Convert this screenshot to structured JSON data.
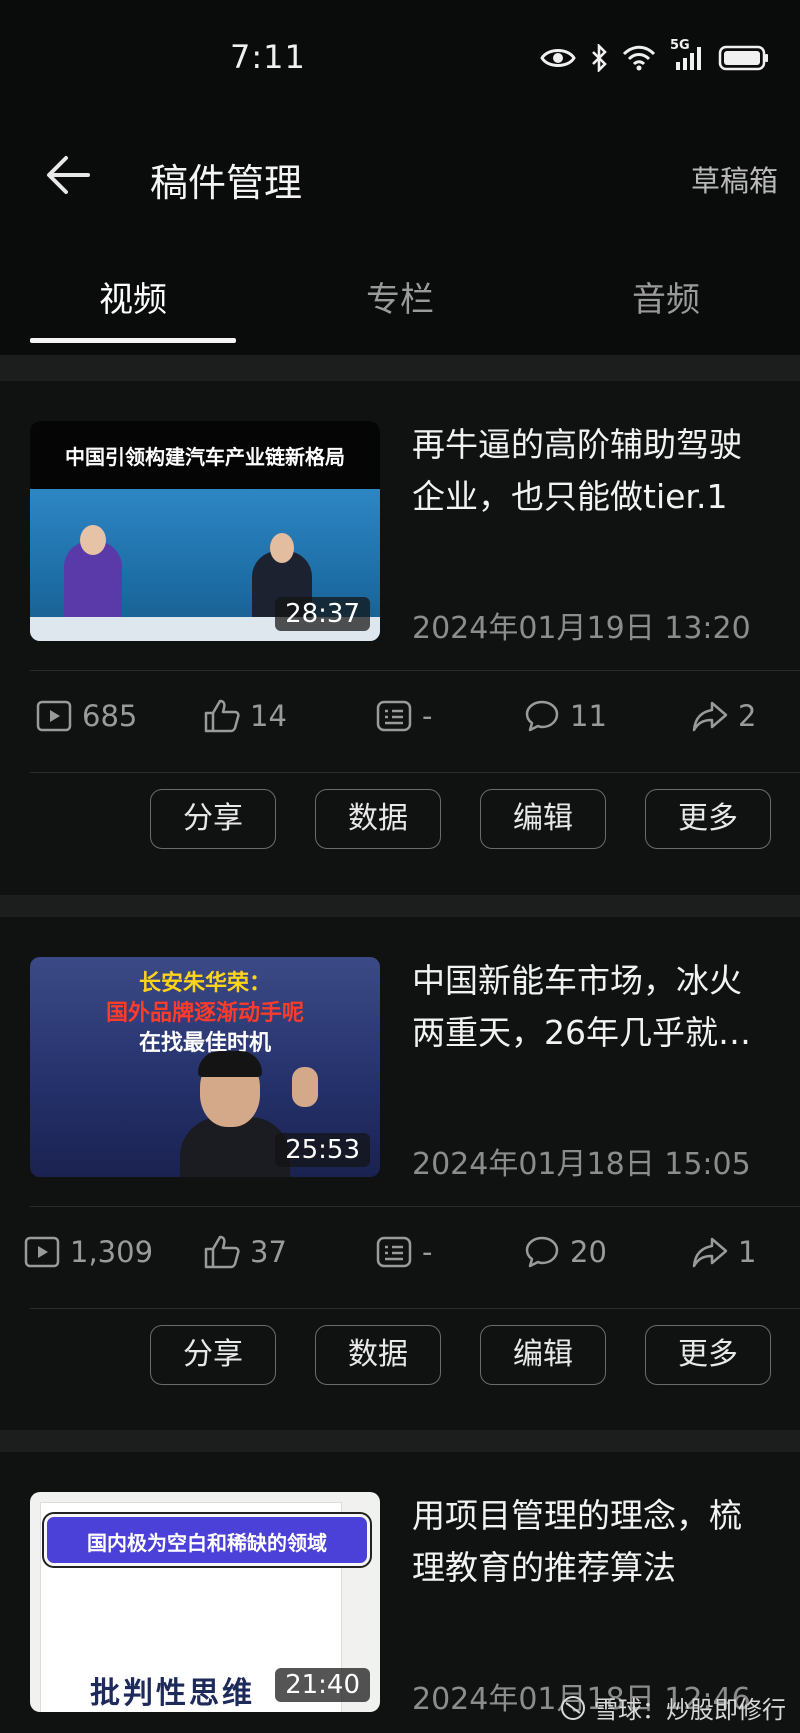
{
  "status_bar": {
    "time": "7:11",
    "network": "5G",
    "icons": [
      "eye-icon",
      "bluetooth-icon",
      "wifi-icon",
      "signal-icon",
      "battery-icon"
    ]
  },
  "app_bar": {
    "title": "稿件管理",
    "drafts": "草稿箱"
  },
  "tabs": [
    {
      "label": "视频",
      "active": true
    },
    {
      "label": "专栏",
      "active": false
    },
    {
      "label": "音频",
      "active": false
    }
  ],
  "items": [
    {
      "title": "再牛逼的高阶辅助驾驶企业，也只能做tier.1",
      "date": "2024年01月19日 13:20",
      "duration": "28:37",
      "thumb_caption": "中国引领构建汽车产业链新格局",
      "stats": {
        "plays": "685",
        "likes": "14",
        "danmaku": "-",
        "comments": "11",
        "shares": "2"
      }
    },
    {
      "title": "中国新能车市场，冰火两重天，26年几乎就…",
      "date": "2024年01月18日 15:05",
      "duration": "25:53",
      "thumb_caption_lines": [
        "长安朱华荣：",
        "国外品牌逐渐动手呢",
        "在找最佳时机"
      ],
      "stats": {
        "plays": "1,309",
        "likes": "37",
        "danmaku": "-",
        "comments": "20",
        "shares": "1"
      }
    },
    {
      "title": "用项目管理的理念，梳理教育的推荐算法",
      "date": "2024年01月18日 12:46",
      "duration": "21:40",
      "thumb_caption": "国内极为空白和稀缺的领域",
      "thumb_book_title": "批判性思维"
    }
  ],
  "actions": {
    "share": "分享",
    "data": "数据",
    "edit": "编辑",
    "more": "更多"
  },
  "watermark": "雪球：炒股即修行",
  "colors": {
    "background": "#0a0b0b",
    "card": "#101212",
    "accent": "#f5f5f5",
    "muted": "#9a9a9a"
  }
}
